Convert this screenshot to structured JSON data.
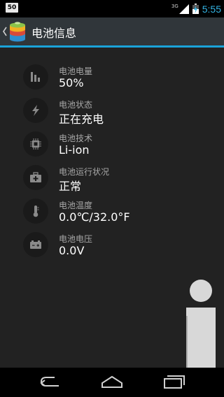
{
  "status_bar": {
    "notification": "50",
    "network": "3G",
    "time": "5:55"
  },
  "action_bar": {
    "title": "电池信息"
  },
  "items": [
    {
      "label": "电池电量",
      "value": "50%",
      "icon": "battery-level-bars-icon"
    },
    {
      "label": "电池状态",
      "value": "正在充电",
      "icon": "lightning-bolt-icon"
    },
    {
      "label": "电池技术",
      "value": "Li-ion",
      "icon": "chip-icon"
    },
    {
      "label": "电池运行状况",
      "value": "正常",
      "icon": "first-aid-kit-icon"
    },
    {
      "label": "电池温度",
      "value": "0.0℃/32.0°F",
      "icon": "thermometer-icon"
    },
    {
      "label": "电池电压",
      "value": "0.0V",
      "icon": "battery-voltage-icon"
    }
  ],
  "colors": {
    "accent": "#1aa3d9",
    "time": "#33b5e5",
    "background": "#222222",
    "action_bar": "#30363a"
  }
}
